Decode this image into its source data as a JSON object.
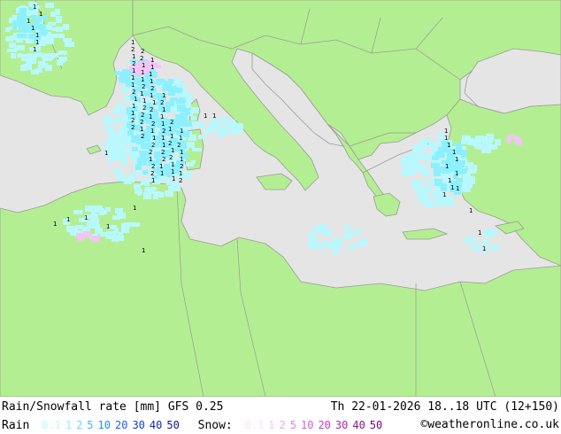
{
  "footer": {
    "title": "Rain/Snowfall rate [mm] GFS 0.25",
    "datetime": "Th 22-01-2026 18..18 UTC (12+150)",
    "credit": "©weatheronline.co.uk"
  },
  "legend": {
    "rain_label": "Rain",
    "snow_label": "Snow:",
    "rain_ticks": [
      {
        "label": "0.1",
        "color": "#b8f8ff"
      },
      {
        "label": "1",
        "color": "#8cf0ff"
      },
      {
        "label": "2",
        "color": "#5fdcff"
      },
      {
        "label": "5",
        "color": "#3ab8ff"
      },
      {
        "label": "10",
        "color": "#1f8cff"
      },
      {
        "label": "20",
        "color": "#1a60ee"
      },
      {
        "label": "30",
        "color": "#1640c8"
      },
      {
        "label": "40",
        "color": "#1428a8"
      },
      {
        "label": "50",
        "color": "#101890"
      }
    ],
    "snow_ticks": [
      {
        "label": "0.1",
        "color": "#fbe0fb"
      },
      {
        "label": "1",
        "color": "#f4c4f4"
      },
      {
        "label": "2",
        "color": "#eda4ed"
      },
      {
        "label": "5",
        "color": "#e27ee2"
      },
      {
        "label": "10",
        "color": "#d55ad5"
      },
      {
        "label": "20",
        "color": "#c43cc4"
      },
      {
        "label": "30",
        "color": "#ac24ac"
      },
      {
        "label": "40",
        "color": "#921292"
      },
      {
        "label": "50",
        "color": "#780478"
      }
    ]
  },
  "map": {
    "land_color": "#b4ee92",
    "sea_color": "#e5e5e5",
    "border_color": "#9a9a9a",
    "rain_light_color": "#b8f8ff",
    "rain_medium_color": "#8cf0ff",
    "snow_color": "#f4c4f4",
    "digit_color": "#000000"
  }
}
